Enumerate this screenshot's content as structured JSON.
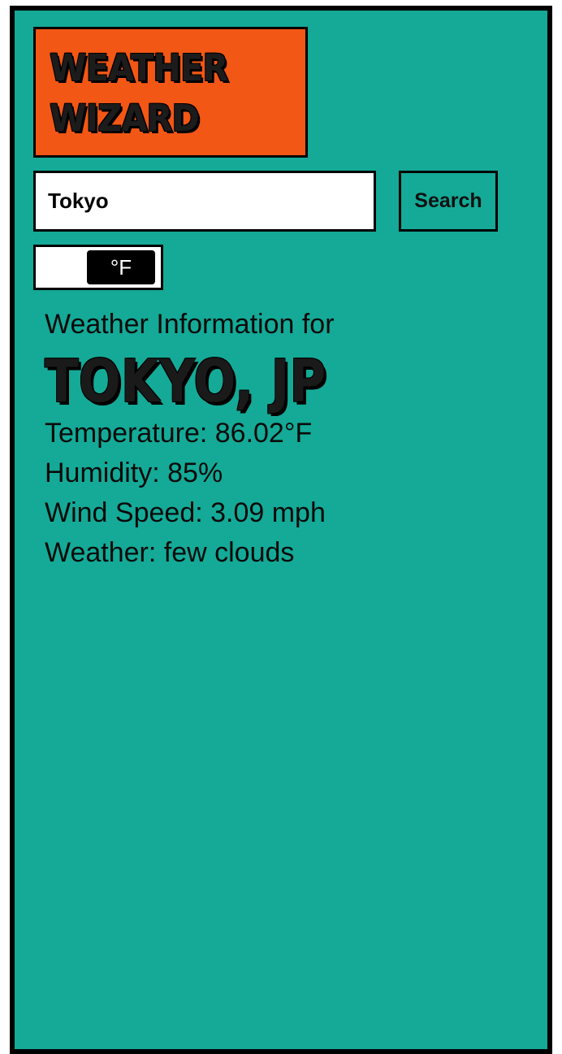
{
  "app": {
    "logo_line_1": "WEATHER",
    "logo_line_2": "WIZARD"
  },
  "search": {
    "value": "Tokyo",
    "button_label": "Search"
  },
  "unit_toggle": {
    "selected_unit": "°F"
  },
  "weather": {
    "heading": "Weather Information for",
    "city": "TOKYO, JP",
    "temperature": "Temperature: 86.02°F",
    "humidity": "Humidity: 85%",
    "wind_speed": "Wind Speed: 3.09 mph",
    "condition": "Weather: few clouds"
  },
  "colors": {
    "background": "#14aa97",
    "logo_background": "#f35715",
    "border": "#000000"
  }
}
